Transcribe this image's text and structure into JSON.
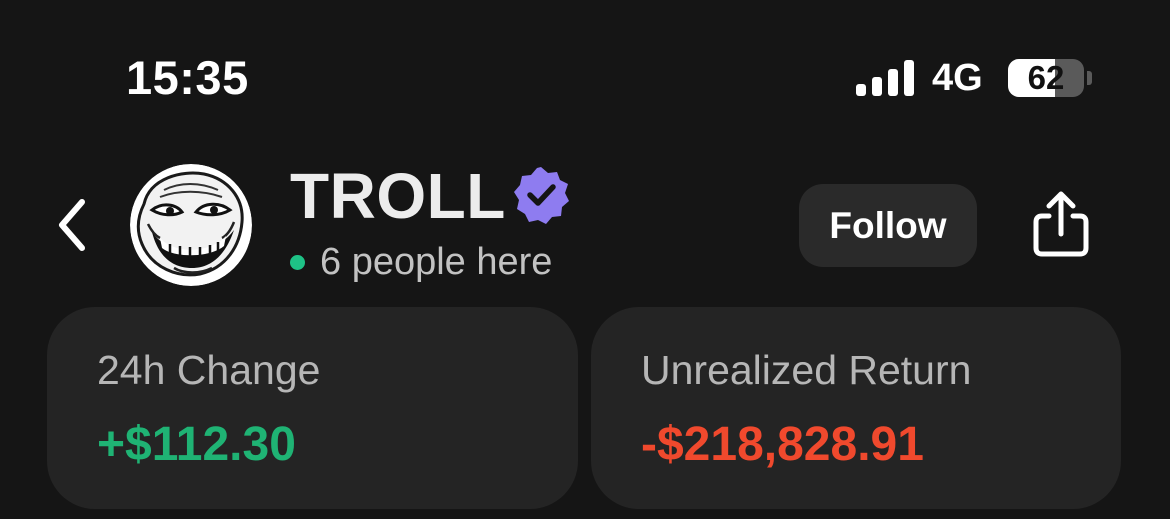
{
  "status_bar": {
    "time": "15:35",
    "network": "4G",
    "battery_level": "62",
    "signal_bars": 4
  },
  "header": {
    "title": "TROLL",
    "verified_icon": "verified-badge-icon",
    "presence_text": "6 people here",
    "follow_label": "Follow",
    "back_icon": "chevron-left-icon",
    "share_icon": "share-icon",
    "avatar_icon": "trollface-avatar"
  },
  "stats": {
    "change_24h": {
      "label": "24h Change",
      "value": "+$112.30"
    },
    "unrealized_return": {
      "label": "Unrealized Return",
      "value": "-$218,828.91"
    }
  },
  "colors": {
    "background": "#151515",
    "card": "#242424",
    "positive": "#1fb374",
    "negative": "#f0492d",
    "verified": "#8e7cf0",
    "presence_dot": "#1ec286"
  }
}
